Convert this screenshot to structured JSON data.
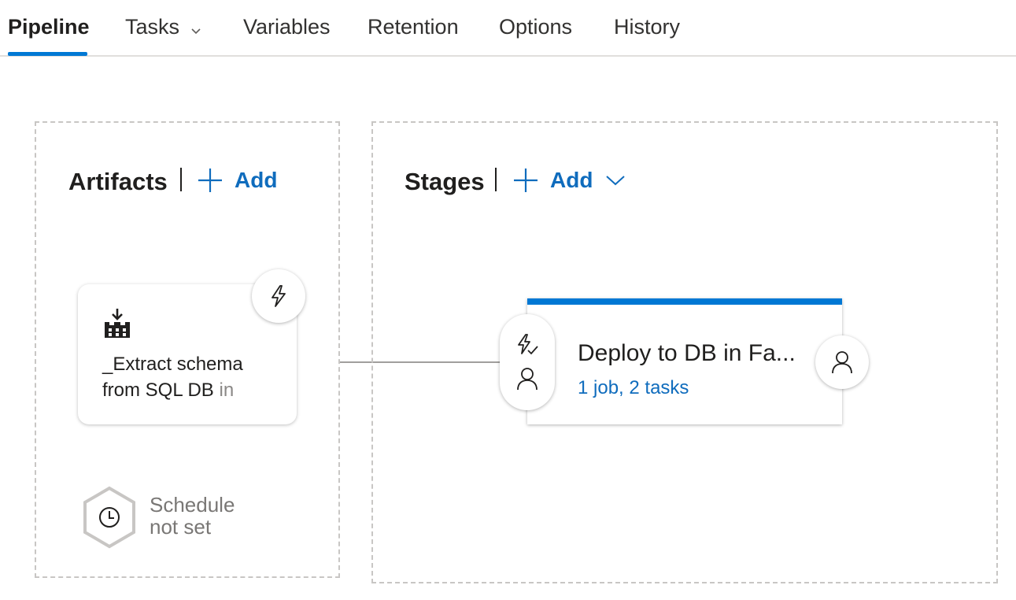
{
  "tabs": [
    {
      "label": "Pipeline",
      "active": true
    },
    {
      "label": "Tasks",
      "active": false,
      "has_dropdown": true
    },
    {
      "label": "Variables",
      "active": false
    },
    {
      "label": "Retention",
      "active": false
    },
    {
      "label": "Options",
      "active": false
    },
    {
      "label": "History",
      "active": false
    }
  ],
  "artifacts": {
    "title": "Artifacts",
    "add_label": "Add",
    "card": {
      "name_line1": "_Extract schema",
      "name_line2": "from SQL DB",
      "name_fade": "in",
      "icon": "build-artifact-icon",
      "trigger_icon": "lightning-icon"
    },
    "schedule": {
      "line1": "Schedule",
      "line2": "not set",
      "icon": "clock-icon"
    }
  },
  "stages": {
    "title": "Stages",
    "add_label": "Add",
    "stage": {
      "name": "Deploy to DB in Fa...",
      "summary": "1 job, 2 tasks",
      "pre_icons": [
        "lightning-check-icon",
        "person-icon"
      ],
      "post_icon": "person-icon"
    }
  },
  "colors": {
    "accent": "#0078d4",
    "link": "#0f6cbd",
    "border": "#c8c6c4"
  }
}
